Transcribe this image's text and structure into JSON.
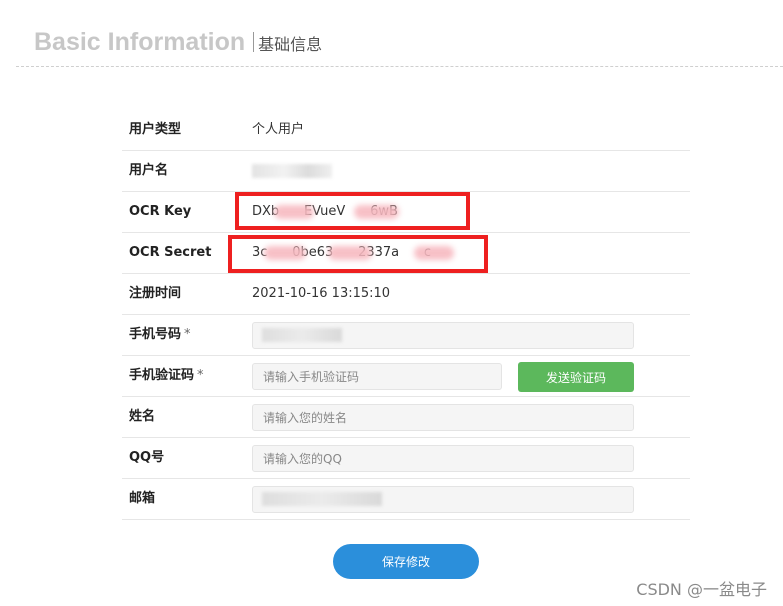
{
  "header": {
    "title_en": "Basic Information",
    "title_zh": "基础信息"
  },
  "fields": {
    "user_type": {
      "label": "用户类型",
      "value": "个人用户"
    },
    "username": {
      "label": "用户名",
      "value": ""
    },
    "ocr_key": {
      "label": "OCR Key",
      "value": "DXb      EVueV      6wB"
    },
    "ocr_secret": {
      "label": "OCR Secret",
      "value": "3c      0be63      2337a      c"
    },
    "register_time": {
      "label": "注册时间",
      "value": "2021-10-16 13:15:10"
    },
    "phone": {
      "label": "手机号码",
      "required_mark": "*",
      "value": ""
    },
    "sms_code": {
      "label": "手机验证码",
      "required_mark": "*",
      "placeholder": "请输入手机验证码",
      "button_label": "发送验证码"
    },
    "name": {
      "label": "姓名",
      "placeholder": "请输入您的姓名"
    },
    "qq": {
      "label": "QQ号",
      "placeholder": "请输入您的QQ"
    },
    "email": {
      "label": "邮箱",
      "value": ""
    }
  },
  "actions": {
    "save_label": "保存修改"
  },
  "watermark": "CSDN @一盆电子",
  "colors": {
    "primary": "#2b8fdb",
    "success": "#5cb85c",
    "highlight": "#ee2020"
  }
}
